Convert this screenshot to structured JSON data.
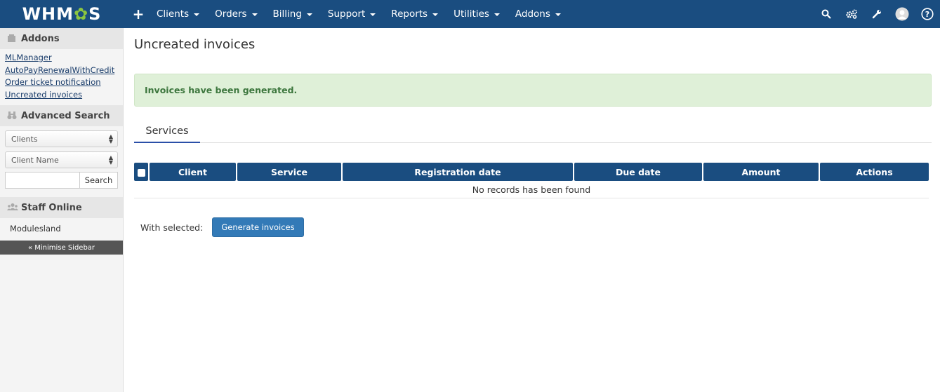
{
  "header": {
    "logo_text_pre": "WHM",
    "logo_text_gear": "✿",
    "logo_text_post": "S",
    "add_icon": "plus-icon",
    "nav": [
      {
        "label": "Clients"
      },
      {
        "label": "Orders"
      },
      {
        "label": "Billing"
      },
      {
        "label": "Support"
      },
      {
        "label": "Reports"
      },
      {
        "label": "Utilities"
      },
      {
        "label": "Addons"
      }
    ],
    "right_icons": [
      "search-icon",
      "gears-icon",
      "wrench-icon",
      "avatar-icon",
      "help-icon"
    ]
  },
  "sidebar": {
    "addons_title": "Addons",
    "addon_links": [
      "MLManager",
      "AutoPayRenewalWithCredit",
      "Order ticket notification",
      "Uncreated invoices"
    ],
    "advanced_search_title": "Advanced Search",
    "search_type_value": "Clients",
    "search_field_value": "Client Name",
    "search_input_value": "",
    "search_button": "Search",
    "staff_online_title": "Staff Online",
    "staff_online": [
      "Modulesland"
    ],
    "minimise_label": "« Minimise Sidebar"
  },
  "main": {
    "page_title": "Uncreated invoices",
    "alert_message": "Invoices have been generated.",
    "tabs": [
      {
        "label": "Services"
      }
    ],
    "table": {
      "columns": [
        "Client",
        "Service",
        "Registration date",
        "Due date",
        "Amount",
        "Actions"
      ],
      "empty_message": "No records has been found"
    },
    "with_selected_label": "With selected:",
    "generate_button": "Generate invoices"
  },
  "colors": {
    "topbar": "#1a4d80",
    "alert_bg": "#dff0d8",
    "alert_text": "#3c763d",
    "primary_button": "#337ab7",
    "logo_accent": "#8cc63f"
  }
}
